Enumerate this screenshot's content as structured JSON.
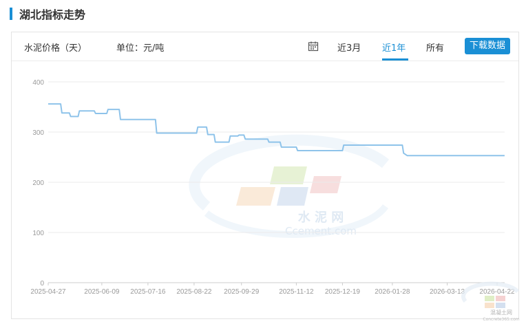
{
  "page": {
    "title": "湖北指标走势",
    "series_label": "水泥价格（天）",
    "unit_label": "单位：元/吨",
    "ranges": [
      "近3月",
      "近1年",
      "所有"
    ],
    "active_range": "近1年",
    "download_label": "下载数据",
    "watermark_text": "水 泥 网",
    "watermark_url": "Ccement.com",
    "corner_logo_text": "混凝土网",
    "corner_logo_url": "Concrete365.com"
  },
  "colors": {
    "accent": "#1a8fd5",
    "line": "#8ec3ea"
  },
  "chart_data": {
    "type": "line",
    "title": "",
    "xlabel": "",
    "ylabel": "",
    "ylim": [
      0,
      400
    ],
    "yticks": [
      0,
      100,
      200,
      300,
      400
    ],
    "xticks": [
      "2025-04-27",
      "2025-06-09",
      "2025-07-16",
      "2025-08-22",
      "2025-09-29",
      "2025-11-12",
      "2025-12-19",
      "2026-01-28",
      "2026-03-13",
      "2026-04-22"
    ],
    "grid": true,
    "legend": "none",
    "series": [
      {
        "x": [
          "2025-04-27",
          "2025-05-07",
          "2025-05-08",
          "2025-05-14",
          "2025-05-15",
          "2025-05-21",
          "2025-05-22",
          "2025-06-03",
          "2025-06-04",
          "2025-06-13",
          "2025-06-14",
          "2025-06-23",
          "2025-06-24",
          "2025-07-22",
          "2025-07-23",
          "2025-08-24",
          "2025-08-25",
          "2025-09-01",
          "2025-09-02",
          "2025-09-07",
          "2025-09-08",
          "2025-09-19",
          "2025-09-20",
          "2025-09-26",
          "2025-09-27",
          "2025-10-01",
          "2025-10-02",
          "2025-10-20",
          "2025-10-21",
          "2025-10-30",
          "2025-10-31",
          "2025-11-12",
          "2025-11-13",
          "2025-12-19",
          "2025-12-20",
          "2026-02-05",
          "2026-02-06",
          "2026-02-09",
          "2026-04-28"
        ],
        "y": [
          356,
          356,
          338,
          338,
          331,
          331,
          342,
          342,
          337,
          337,
          345,
          345,
          325,
          325,
          298,
          298,
          310,
          310,
          295,
          295,
          280,
          280,
          292,
          292,
          294,
          294,
          286,
          286,
          280,
          280,
          270,
          270,
          263,
          263,
          274,
          274,
          258,
          253,
          253
        ]
      }
    ]
  }
}
